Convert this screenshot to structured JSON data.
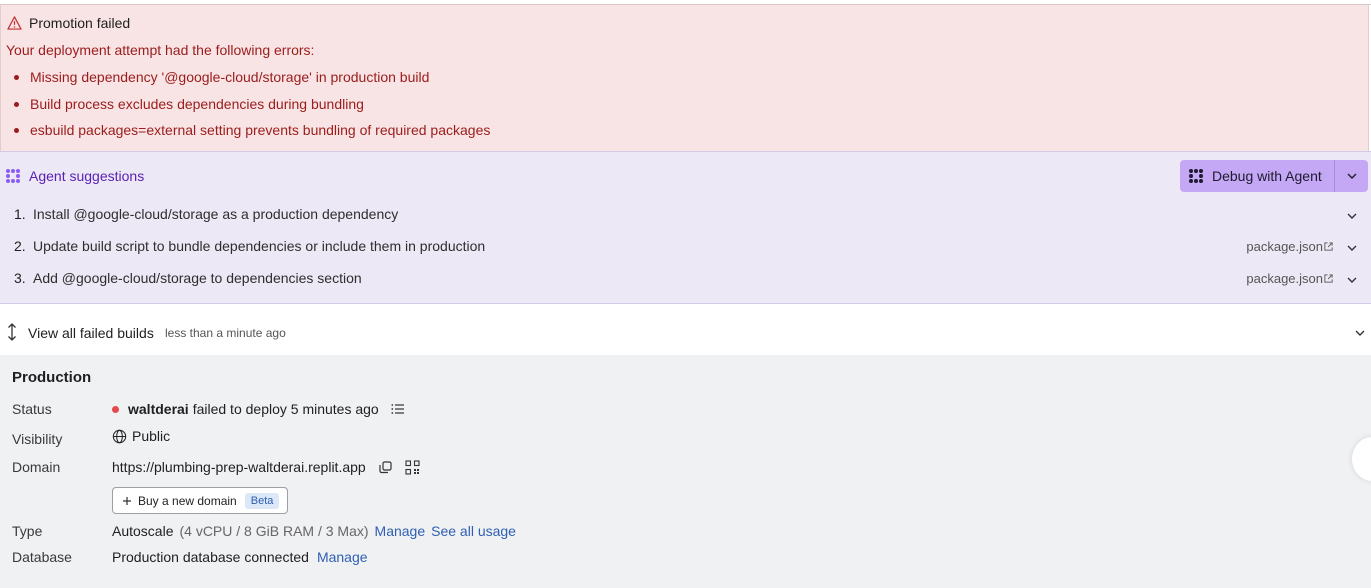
{
  "error": {
    "title": "Promotion failed",
    "subtitle": "Your deployment attempt had the following errors:",
    "items": [
      "Missing dependency '@google-cloud/storage' in production build",
      "Build process excludes dependencies during bundling",
      "esbuild packages=external setting prevents bundling of required packages"
    ]
  },
  "agent": {
    "title": "Agent suggestions",
    "debug_label": "Debug with Agent",
    "suggestions": [
      {
        "num": "1.",
        "text": "Install @google-cloud/storage as a production dependency",
        "file": ""
      },
      {
        "num": "2.",
        "text": "Update build script to bundle dependencies or include them in production",
        "file": "package.json"
      },
      {
        "num": "3.",
        "text": "Add @google-cloud/storage to dependencies section",
        "file": "package.json"
      }
    ]
  },
  "builds": {
    "label": "View all failed builds",
    "time": "less than a minute ago"
  },
  "production": {
    "heading": "Production",
    "labels": {
      "status": "Status",
      "visibility": "Visibility",
      "domain": "Domain",
      "type": "Type",
      "database": "Database"
    },
    "status": {
      "user": "waltderai",
      "text": "failed to deploy 5 minutes ago"
    },
    "visibility": "Public",
    "domain": "https://plumbing-prep-waltderai.replit.app",
    "buy_domain": "Buy a new domain",
    "beta": "Beta",
    "type": {
      "name": "Autoscale",
      "spec": "(4 vCPU / 8 GiB RAM / 3 Max)",
      "manage": "Manage",
      "usage": "See all usage"
    },
    "database": {
      "text": "Production database connected",
      "manage": "Manage"
    }
  },
  "colors": {
    "error_bg": "#f8e4e4",
    "error_text": "#9b1c1c",
    "agent_bg": "#ece8f6",
    "agent_accent": "#5b21b6",
    "debug_btn": "#c4a8f5",
    "link": "#2f5fb3",
    "status_dot": "#e5484d"
  }
}
